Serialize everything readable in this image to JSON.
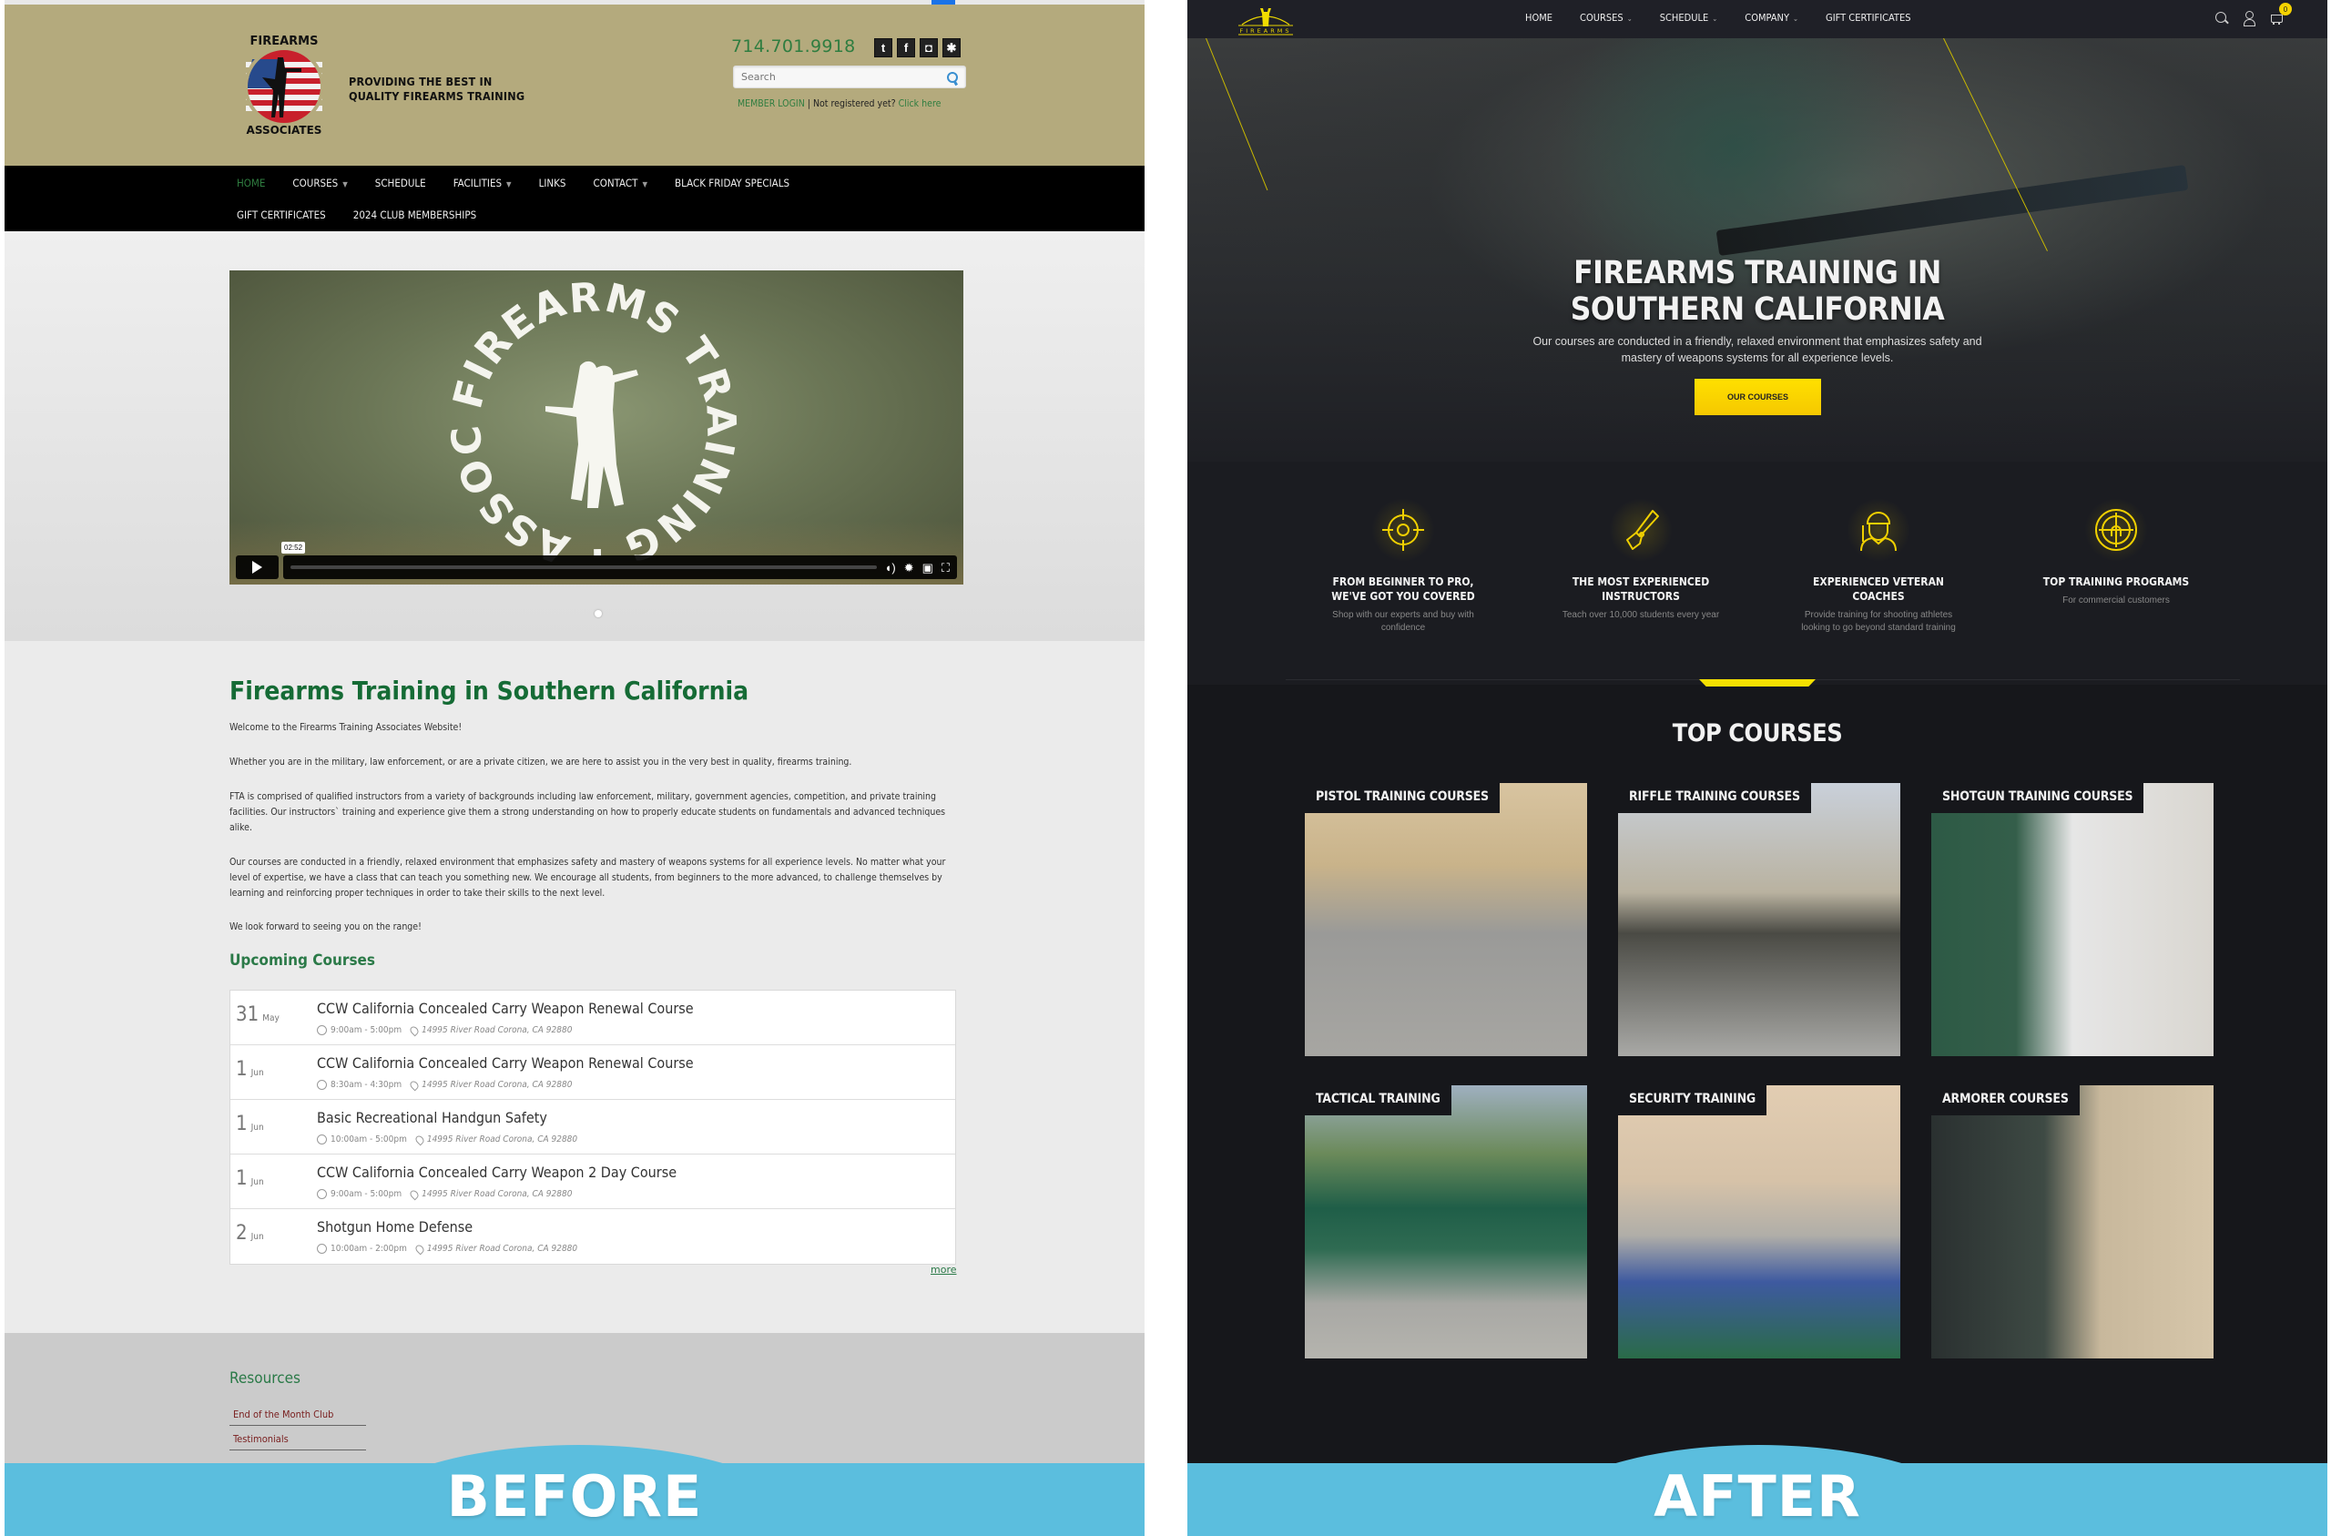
{
  "before": {
    "badge": "BEFORE",
    "header": {
      "logo_alt": "Firearms Training Associates",
      "tagline_lines": [
        "PROVIDING THE BEST IN",
        "QUALITY FIREARMS TRAINING"
      ],
      "phone": "714.701.9918",
      "social": [
        {
          "icon": "twitter-icon",
          "glyph": "t"
        },
        {
          "icon": "facebook-icon",
          "glyph": "f"
        },
        {
          "icon": "instagram-icon",
          "glyph": "◘"
        },
        {
          "icon": "yelp-icon",
          "glyph": "✱"
        }
      ],
      "search_placeholder": "Search",
      "member_login": "MEMBER LOGIN",
      "separator": " | ",
      "not_registered": "Not registered yet? ",
      "click_here": "Click here"
    },
    "nav": {
      "row1": [
        {
          "label": "HOME",
          "active": true,
          "dropdown": false
        },
        {
          "label": "COURSES",
          "dropdown": true
        },
        {
          "label": "SCHEDULE",
          "dropdown": false
        },
        {
          "label": "FACILITIES",
          "dropdown": true
        },
        {
          "label": "LINKS",
          "dropdown": false
        },
        {
          "label": "CONTACT",
          "dropdown": true
        },
        {
          "label": "BLACK FRIDAY SPECIALS",
          "dropdown": false
        }
      ],
      "row2": [
        {
          "label": "GIFT CERTIFICATES"
        },
        {
          "label": "2024 CLUB MEMBERSHIPS"
        }
      ]
    },
    "video": {
      "emblem_text_top": "FIREARMS",
      "emblem_text_right": "TRAINING",
      "emblem_text_bottom": "ASSOCIATES",
      "time_tooltip": "02:52",
      "progress": 0
    },
    "content": {
      "title": "Firearms Training in Southern California",
      "paragraphs": [
        "Welcome to the Firearms Training Associates Website!",
        "Whether you are in the military, law enforcement, or are a private citizen, we are here to assist you in the very best in quality, firearms training.",
        "FTA is comprised of qualified instructors from a variety of backgrounds including law enforcement, military, government agencies, competition, and private training facilities. Our instructors` training and experience give them a strong understanding on how to properly educate students on fundamentals and advanced techniques alike.",
        "Our courses are conducted in a friendly, relaxed environment that emphasizes safety and mastery of weapons systems for all experience levels. No matter what your level of expertise, we have a class that can teach you something new. We encourage all students, from beginners to the more advanced, to challenge themselves by learning and reinforcing proper techniques in order to take their skills to the next level.",
        "We look forward to seeing you on the range!"
      ],
      "upcoming_title": "Upcoming Courses",
      "events": [
        {
          "day": "31",
          "month": "May",
          "title": "CCW California Concealed Carry Weapon Renewal Course",
          "time": "9:00am - 5:00pm",
          "location": "14995 River Road  Corona, CA 92880"
        },
        {
          "day": "1",
          "month": "Jun",
          "title": "CCW California Concealed Carry Weapon Renewal Course",
          "time": "8:30am - 4:30pm",
          "location": "14995 River Road  Corona, CA 92880"
        },
        {
          "day": "1",
          "month": "Jun",
          "title": "Basic Recreational Handgun Safety",
          "time": "10:00am - 5:00pm",
          "location": "14995 River Road  Corona, CA 92880"
        },
        {
          "day": "1",
          "month": "Jun",
          "title": "CCW California Concealed Carry Weapon 2 Day Course",
          "time": "9:00am - 5:00pm",
          "location": "14995 River Road  Corona, CA 92880"
        },
        {
          "day": "2",
          "month": "Jun",
          "title": "Shotgun Home Defense",
          "time": "10:00am - 2:00pm",
          "location": "14995 River Road  Corona, CA 92880"
        }
      ],
      "more_link": "more"
    },
    "footer": {
      "resources_title": "Resources",
      "links": [
        "End of the Month Club",
        "Testimonials"
      ]
    }
  },
  "after": {
    "badge": "AFTER",
    "nav": {
      "logo_text": "FIREARMS",
      "items": [
        {
          "label": "HOME",
          "dropdown": false
        },
        {
          "label": "COURSES",
          "dropdown": true
        },
        {
          "label": "SCHEDULE",
          "dropdown": true
        },
        {
          "label": "COMPANY",
          "dropdown": true
        },
        {
          "label": "GIFT CERTIFICATES",
          "dropdown": false
        }
      ],
      "cart_count": "0"
    },
    "hero": {
      "title_lines": [
        "FIREARMS TRAINING IN",
        "SOUTHERN CALIFORNIA"
      ],
      "subtitle_lines": [
        "Our courses are conducted in a friendly, relaxed environment that emphasizes safety and",
        "mastery of weapons systems for all experience levels."
      ],
      "cta": "OUR COURSES"
    },
    "features": [
      {
        "icon": "crosshair-icon",
        "title_lines": [
          "FROM BEGINNER TO PRO,",
          "WE'VE GOT YOU COVERED"
        ],
        "text_lines": [
          "Shop with our experts and buy with",
          "confidence"
        ]
      },
      {
        "icon": "pistol-icon",
        "title_lines": [
          "THE MOST EXPERIENCED",
          "INSTRUCTORS"
        ],
        "text_lines": [
          "Teach over 10,000 students every year"
        ]
      },
      {
        "icon": "soldier-icon",
        "title_lines": [
          "EXPERIENCED VETERAN",
          "COACHES"
        ],
        "text_lines": [
          "Provide training for shooting athletes",
          "looking to go beyond standard training"
        ]
      },
      {
        "icon": "target-icon",
        "title_lines": [
          "TOP TRAINING PROGRAMS"
        ],
        "text_lines": [
          "For commercial customers"
        ]
      }
    ],
    "top_courses": {
      "title": "TOP COURSES",
      "cards": [
        {
          "label": "PISTOL TRAINING COURSES"
        },
        {
          "label": "RIFFLE TRAINING COURSES"
        },
        {
          "label": "SHOTGUN TRAINING COURSES"
        },
        {
          "label": "TACTICAL TRAINING"
        },
        {
          "label": "SECURITY TRAINING"
        },
        {
          "label": "ARMORER COURSES"
        }
      ]
    }
  },
  "colors": {
    "before_header_bg": "#b4aa7d",
    "before_green": "#156b35",
    "after_bg": "#16171b",
    "after_accent": "#f5d300",
    "badge_blue": "#5bbede"
  }
}
